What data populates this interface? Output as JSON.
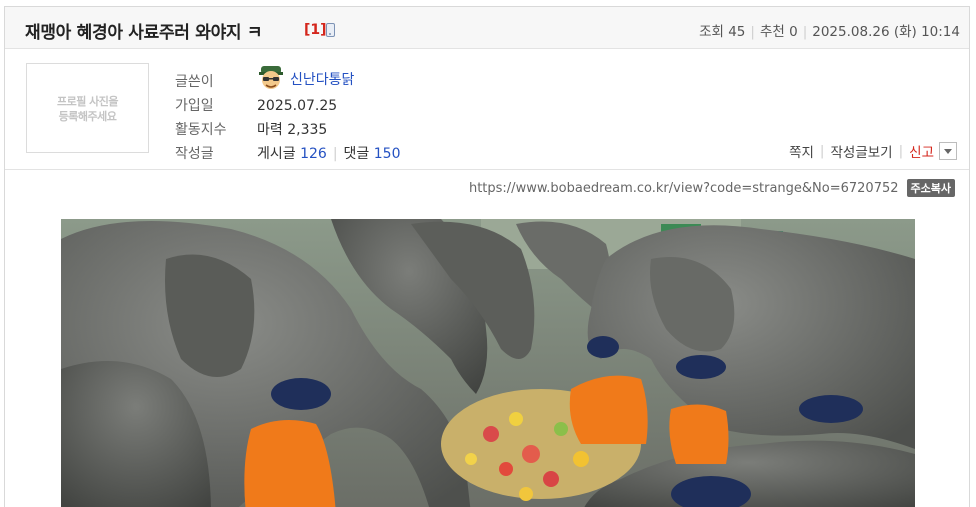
{
  "post": {
    "title": "재맹아 혜경아 사료주러 와야지 ㅋ",
    "comment_count": "[1]",
    "views_label": "조회",
    "views": "45",
    "recommend_label": "추천",
    "recommend": "0",
    "datetime": "2025.08.26 (화) 10:14"
  },
  "profile": {
    "photo_placeholder_line1": "프로필 사진을",
    "photo_placeholder_line2": "등록해주세요",
    "author_label": "글쓴이",
    "nickname": "신난다통닭",
    "joined_label": "가입일",
    "joined": "2025.07.25",
    "activity_label": "활동지수",
    "activity_prefix": "마력",
    "activity_value": "2,335",
    "posts_label": "작성글",
    "posts_prefix": "게시글",
    "posts_count": "126",
    "comments_prefix": "댓글",
    "comments_count": "150"
  },
  "actions": {
    "message": "쪽지",
    "view_posts": "작성글보기",
    "report": "신고"
  },
  "url": {
    "text": "https://www.bobaedream.co.kr/view?code=strange&No=6720752",
    "copy_label": "주소복사"
  },
  "colors": {
    "link_blue": "#2451c2",
    "alert_red": "#d4261c",
    "shirt_orange": "#f07a1a"
  },
  "icons": [
    "mobile-icon",
    "avatar-icon",
    "dropdown-arrow-icon"
  ]
}
